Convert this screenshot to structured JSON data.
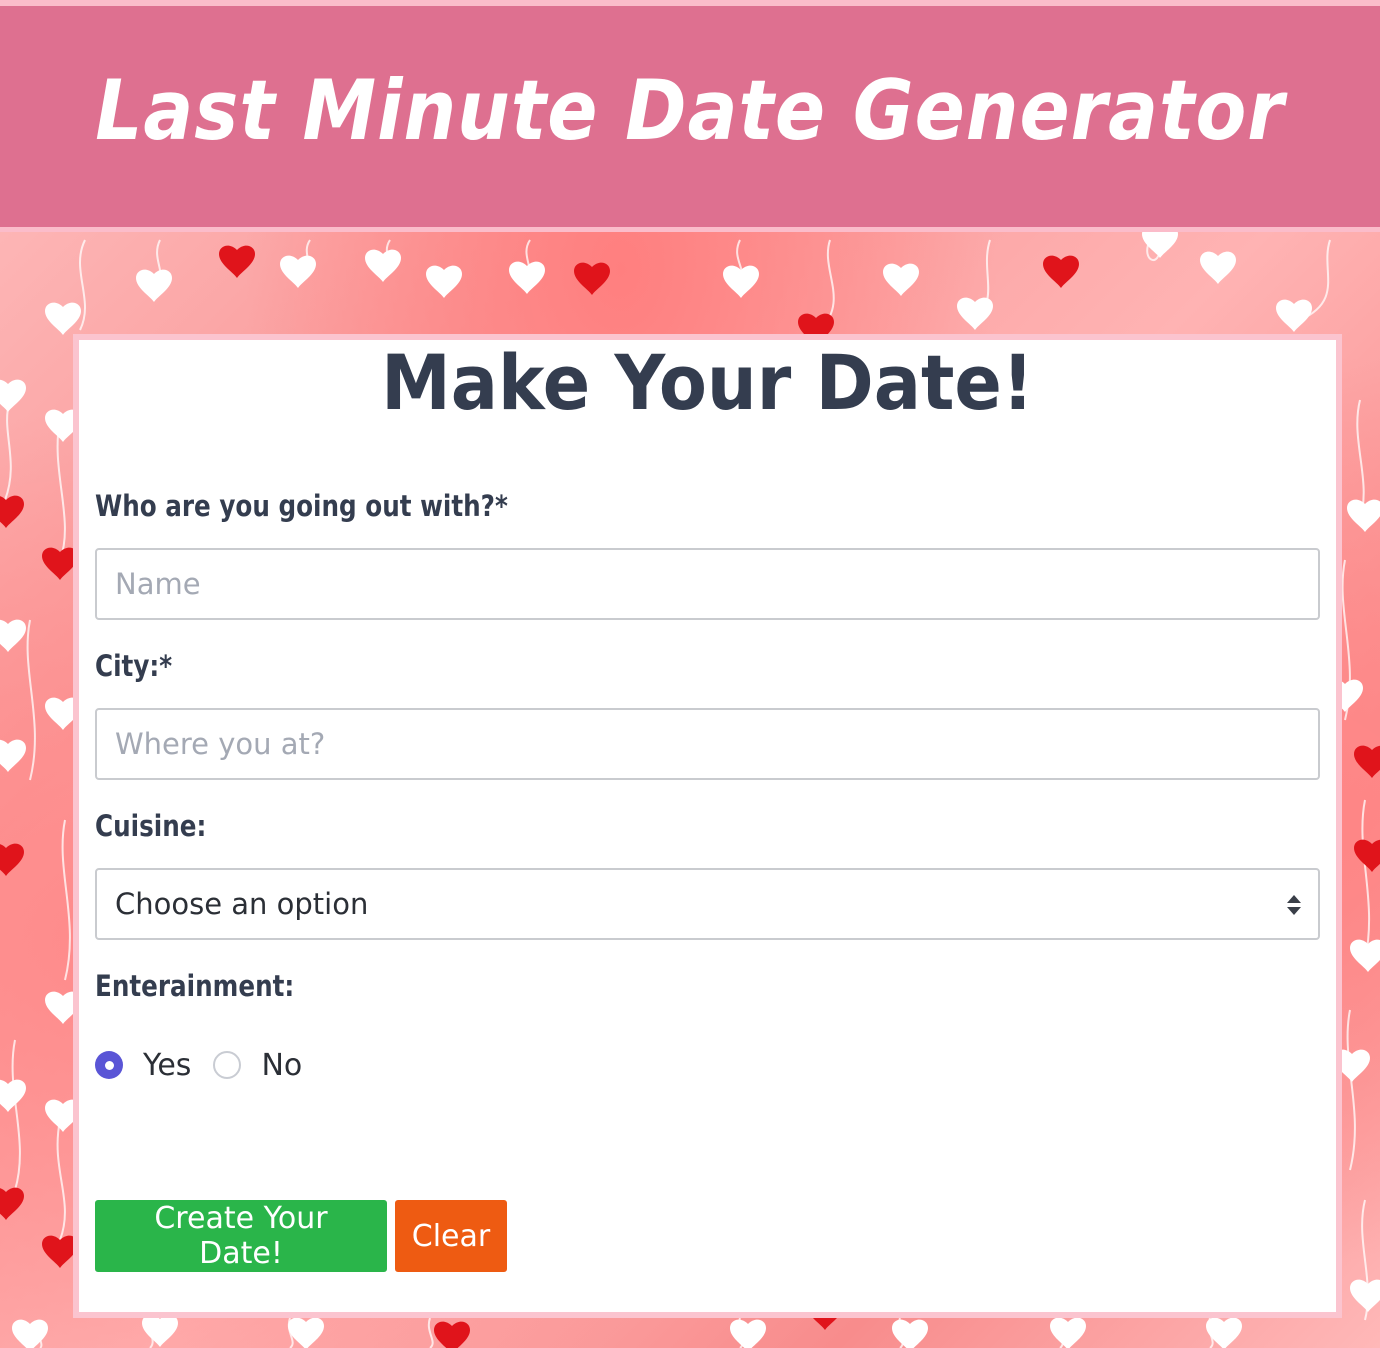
{
  "header": {
    "title": "Last Minute Date Generator"
  },
  "form": {
    "title": "Make Your Date!",
    "name_label": "Who are you going out with?*",
    "name_placeholder": "Name",
    "city_label": "City:*",
    "city_placeholder": "Where you at?",
    "cuisine_label": "Cuisine:",
    "cuisine_selected": "Choose an option",
    "entertainment_label": "Enterainment:",
    "entertainment_options": [
      {
        "label": "Yes",
        "checked": true
      },
      {
        "label": "No",
        "checked": false
      }
    ],
    "create_button": "Create Your Date!",
    "clear_button": "Clear"
  },
  "colors": {
    "header_bg": "#de7090",
    "text_dark": "#343d4f",
    "radio_accent": "#5a55d6",
    "create_button": "#2ab54a",
    "clear_button": "#ee5b12",
    "heart_red": "#e0141b",
    "heart_white": "#ffffff"
  },
  "icons": {
    "select_arrows": "chevron-up-down-icon",
    "background_pattern": "heart-icon"
  }
}
